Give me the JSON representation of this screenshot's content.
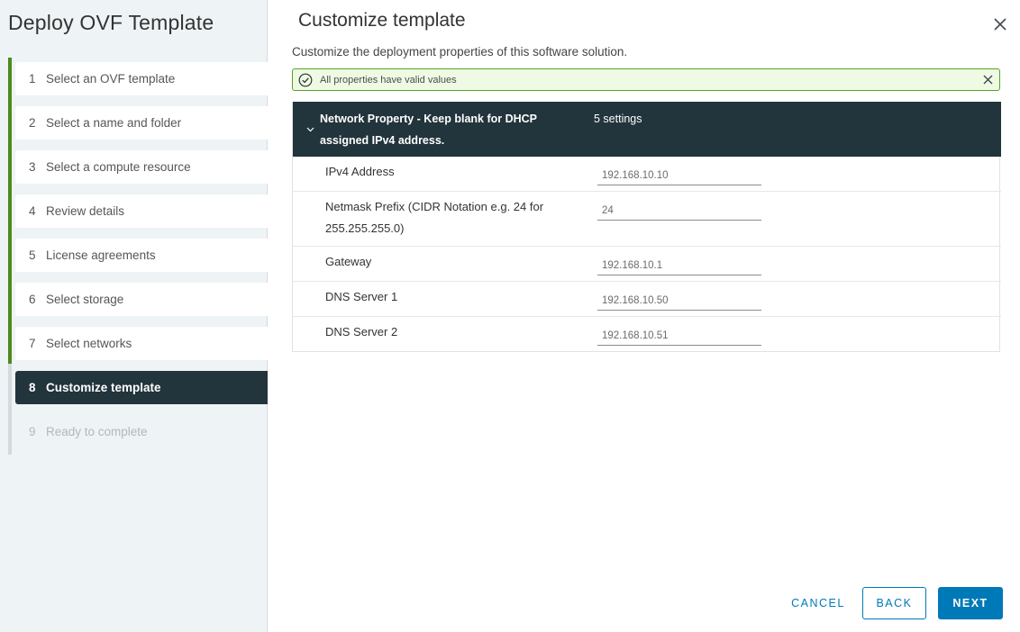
{
  "wizard": {
    "title": "Deploy OVF Template",
    "steps": [
      {
        "num": "1",
        "label": "Select an OVF template",
        "state": "done"
      },
      {
        "num": "2",
        "label": "Select a name and folder",
        "state": "done"
      },
      {
        "num": "3",
        "label": "Select a compute resource",
        "state": "done"
      },
      {
        "num": "4",
        "label": "Review details",
        "state": "done"
      },
      {
        "num": "5",
        "label": "License agreements",
        "state": "done"
      },
      {
        "num": "6",
        "label": "Select storage",
        "state": "done"
      },
      {
        "num": "7",
        "label": "Select networks",
        "state": "done"
      },
      {
        "num": "8",
        "label": "Customize template",
        "state": "active"
      },
      {
        "num": "9",
        "label": "Ready to complete",
        "state": "disabled"
      }
    ]
  },
  "main": {
    "title": "Customize template",
    "subtitle": "Customize the deployment properties of this software solution.",
    "close_icon": "close-icon",
    "alert": {
      "icon": "check-circle-icon",
      "message": "All properties have valid values",
      "status_color": "#5aa220"
    },
    "group": {
      "name": "Network Property - Keep blank for DHCP assigned IPv4 address.",
      "count": "5 settings",
      "expanded": true,
      "properties": [
        {
          "label": "IPv4 Address",
          "value": "192.168.10.10"
        },
        {
          "label": "Netmask Prefix (CIDR Notation e.g. 24 for 255.255.255.0)",
          "value": "24"
        },
        {
          "label": "Gateway",
          "value": "192.168.10.1"
        },
        {
          "label": "DNS Server 1",
          "value": "192.168.10.50"
        },
        {
          "label": "DNS Server 2",
          "value": "192.168.10.51"
        }
      ]
    }
  },
  "footer": {
    "cancel_label": "CANCEL",
    "back_label": "BACK",
    "next_label": "NEXT",
    "accent_color": "#0079b8"
  }
}
